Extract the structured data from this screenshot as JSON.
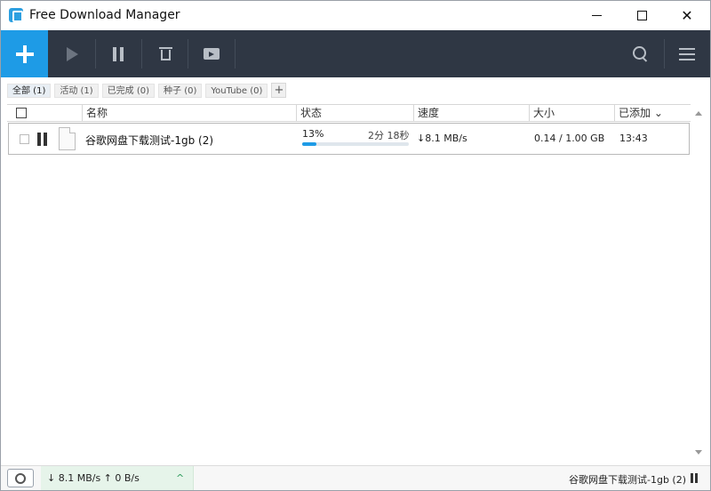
{
  "window": {
    "title": "Free Download Manager",
    "icon": "fdm-app-icon"
  },
  "toolbar": {
    "buttons": [
      {
        "name": "add-download-button",
        "icon": "plus-icon"
      },
      {
        "name": "start-button",
        "icon": "play-icon"
      },
      {
        "name": "pause-all-button",
        "icon": "pause-icon"
      },
      {
        "name": "delete-button",
        "icon": "trash-icon"
      },
      {
        "name": "move-to-folder-button",
        "icon": "folder-move-icon"
      },
      {
        "name": "search-button",
        "icon": "search-icon"
      },
      {
        "name": "main-menu-button",
        "icon": "hamburger-menu-icon"
      }
    ],
    "colors": {
      "background": "#2f3744",
      "accent": "#1e9be6"
    }
  },
  "filters": {
    "tabs": [
      {
        "label": "全部 (1)",
        "active": true
      },
      {
        "label": "活动 (1)",
        "active": false
      },
      {
        "label": "已完成 (0)",
        "active": false
      },
      {
        "label": "种子 (0)",
        "active": false
      },
      {
        "label": "YouTube (0)",
        "active": false
      }
    ],
    "add_label": "+"
  },
  "table": {
    "columns": {
      "name": "名称",
      "status": "状态",
      "speed": "速度",
      "size": "大小",
      "added": "已添加 ⌄"
    },
    "rows": [
      {
        "name": "谷歌网盘下载测试-1gb (2)",
        "progress_label": "13%",
        "progress": 0.13,
        "eta": "2分 18秒",
        "speed": "↓8.1 MB/s",
        "size": "0.14 / 1.00 GB",
        "added": "13:43"
      }
    ]
  },
  "statusbar": {
    "speeds": "↓  8.1 MB/s  ↑ 0 B/s",
    "caret": "^",
    "current_file": "谷歌网盘下载测试-1gb (2)",
    "snail_icon": "snail-speed-mode-icon",
    "accent": "#e6f4ea"
  }
}
